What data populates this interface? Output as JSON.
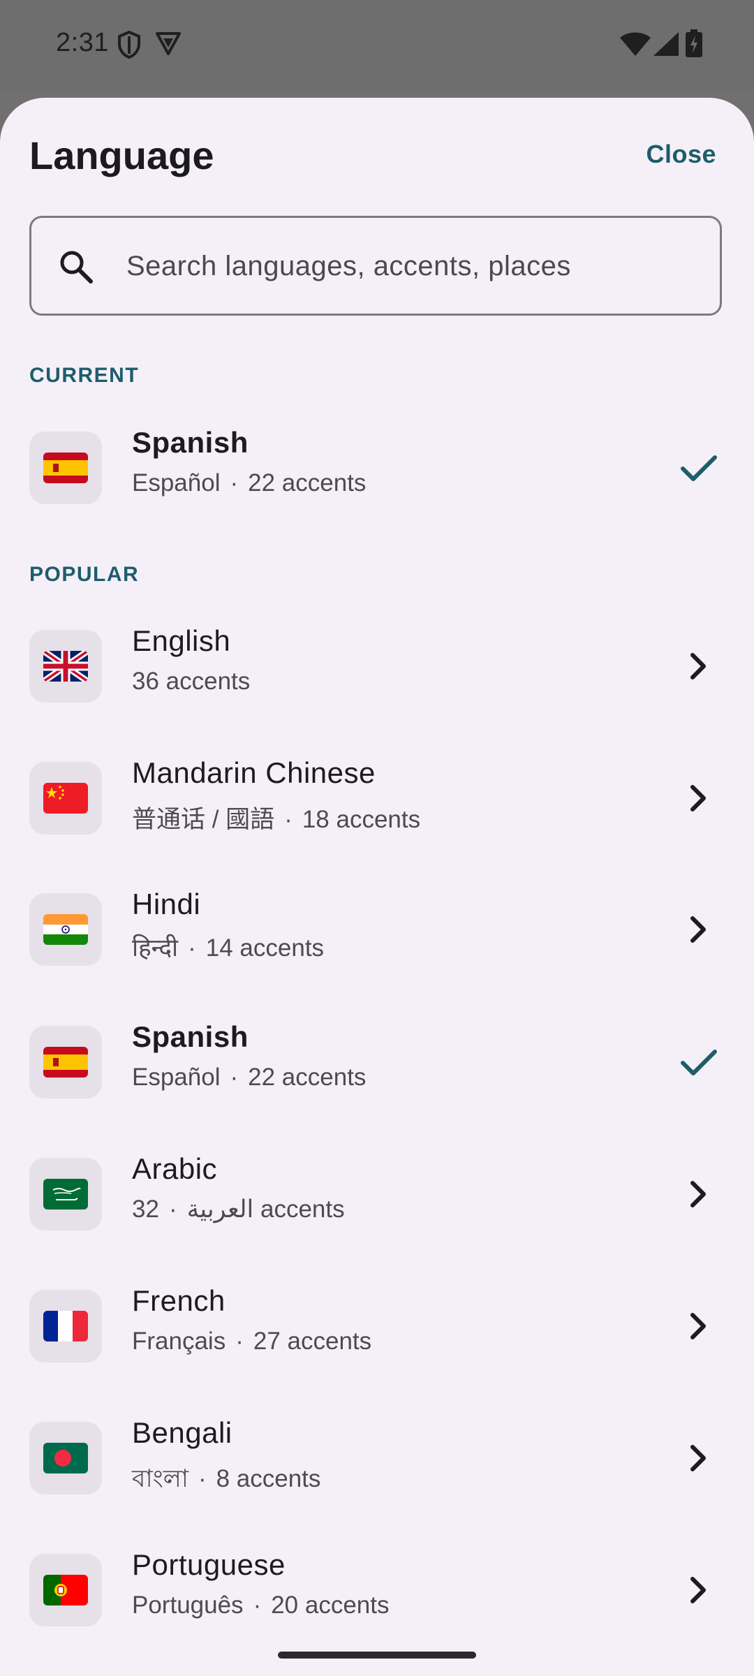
{
  "status_bar": {
    "time": "2:31"
  },
  "sheet": {
    "title": "Language",
    "close_label": "Close"
  },
  "search": {
    "placeholder": "Search languages, accents, places",
    "value": ""
  },
  "sections": {
    "current": "CURRENT",
    "popular": "POPULAR"
  },
  "current_language": {
    "name": "Spanish",
    "native": "Español",
    "accents": "22 accents",
    "flag": "spain-flag-icon",
    "selected": true
  },
  "popular_languages": [
    {
      "name": "English",
      "native": "",
      "accents": "36 accents",
      "flag": "uk-flag-icon",
      "selected": false
    },
    {
      "name": "Mandarin Chinese",
      "native": "普通话 / 國語",
      "accents": "18 accents",
      "flag": "china-flag-icon",
      "selected": false
    },
    {
      "name": "Hindi",
      "native": "हिन्दी",
      "accents": "14 accents",
      "flag": "india-flag-icon",
      "selected": false
    },
    {
      "name": "Spanish",
      "native": "Español",
      "accents": "22 accents",
      "flag": "spain-flag-icon",
      "selected": true
    },
    {
      "name": "Arabic",
      "native": "العربية",
      "accents": "32 accents",
      "flag": "saudi-arabia-flag-icon",
      "selected": false
    },
    {
      "name": "French",
      "native": "Français",
      "accents": "27 accents",
      "flag": "france-flag-icon",
      "selected": false
    },
    {
      "name": "Bengali",
      "native": "বাংলা",
      "accents": "8 accents",
      "flag": "bangladesh-flag-icon",
      "selected": false
    },
    {
      "name": "Portuguese",
      "native": "Português",
      "accents": "20 accents",
      "flag": "portugal-flag-icon",
      "selected": false
    }
  ],
  "colors": {
    "accent": "#1d5d6c",
    "sheet_background": "#f5f0f7",
    "scrim": "#707070"
  }
}
